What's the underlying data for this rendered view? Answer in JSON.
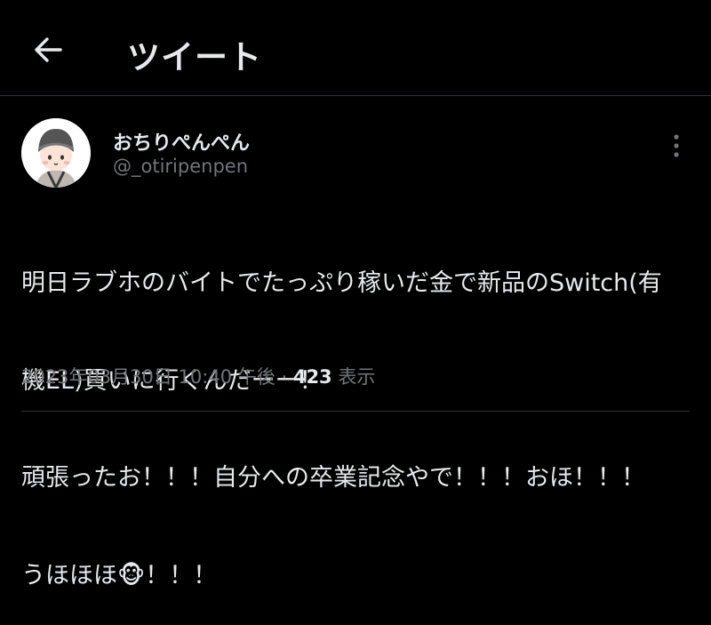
{
  "header": {
    "back_icon": "arrow-left-icon",
    "title": "ツイート"
  },
  "tweet": {
    "author": {
      "display_name": "おちりぺんぺん",
      "handle": "@_otiripenpen",
      "avatar_icon": "cartoon-character-avatar"
    },
    "more_icon": "vertical-ellipsis-icon",
    "text_lines": [
      "明日ラブホのバイトでたっぷり稼いだ金で新品のSwitch(有",
      "機EL)買いに行くんだーー！",
      "頑張ったお！！！自分への卒業記念やで！！！おほ！！！",
      "うほほほ🐵！！！"
    ],
    "meta": {
      "timestamp": "2023年03月30日 10:40 午後",
      "separator": "·",
      "views_count": "423",
      "views_label": "表示"
    }
  },
  "colors": {
    "background": "#000000",
    "primary_text": "#e7e9ea",
    "secondary_text": "#71767b",
    "border": "#2f3336"
  }
}
